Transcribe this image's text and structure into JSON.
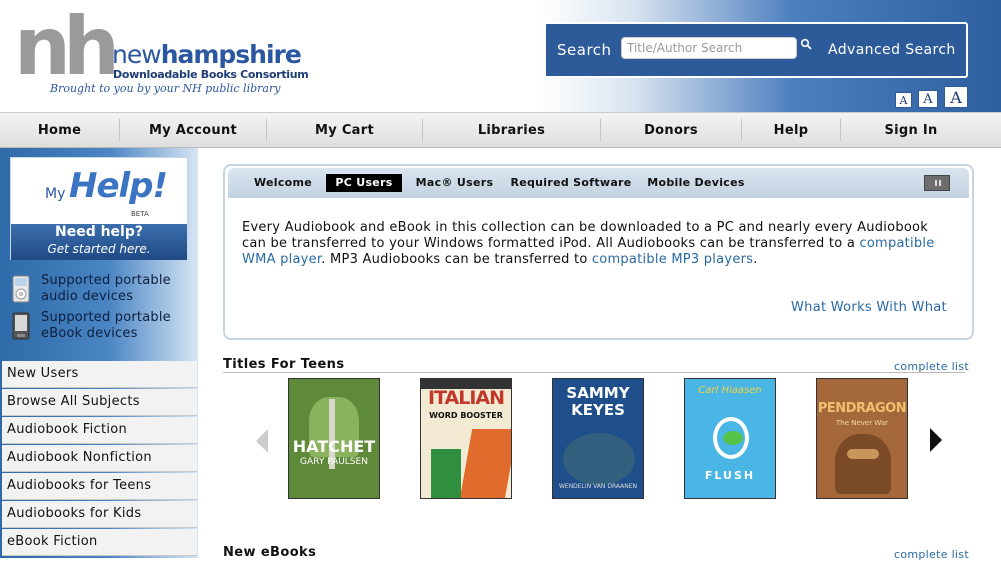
{
  "header": {
    "logo_nh": "nh",
    "logo_new": "new",
    "logo_hampshire": "hampshire",
    "logo_consortium": "Downloadable Books Consortium",
    "logo_tagline": "Brought to you by your NH public library",
    "search_label": "Search",
    "search_placeholder": "Title/Author Search",
    "advanced_search": "Advanced Search",
    "font_small": "A",
    "font_medium": "A",
    "font_large": "A"
  },
  "nav": {
    "items": [
      "Home",
      "My Account",
      "My Cart",
      "Libraries",
      "Donors",
      "Help",
      "Sign In"
    ]
  },
  "sidebar": {
    "myhelp_my": "My",
    "myhelp_help": "Help!",
    "myhelp_beta": "BETA",
    "need_help": "Need help?",
    "get_started": "Get started here.",
    "audio_devices": "Supported portable audio devices",
    "ebook_devices": "Supported portable eBook devices",
    "list": [
      "New Users",
      "Browse All Subjects",
      "Audiobook Fiction",
      "Audiobook Nonfiction",
      "Audiobooks for Teens",
      "Audiobooks for Kids",
      "eBook Fiction"
    ]
  },
  "welcome": {
    "tabs": [
      "Welcome",
      "PC Users",
      "Mac® Users",
      "Required Software",
      "Mobile Devices"
    ],
    "active_tab": "PC Users",
    "text_1": "Every Audiobook and eBook in this collection can be downloaded to a PC and nearly every Audiobook can be transferred to your Windows formatted iPod. All Audiobooks can be transferred to a ",
    "link_wma": "compatible WMA player",
    "text_2": ". MP3 Audiobooks can be transferred to ",
    "link_mp3": "compatible MP3 players",
    "text_3": ".",
    "what_works": "What Works With What"
  },
  "teens": {
    "title": "Titles For Teens",
    "complete_list": "complete list",
    "books": [
      {
        "title": "HATCHET",
        "author": "GARY PAULSEN",
        "bg": "#5f8a3a"
      },
      {
        "title": "ITALIAN",
        "author": "WORD BOOSTER",
        "bg": "#f2ead2"
      },
      {
        "title": "SAMMY KEYES",
        "author": "WENDELIN VAN DRAANEN",
        "bg": "#1f4f8a"
      },
      {
        "title": "FLUSH",
        "author": "Carl Hiaasen",
        "bg": "#49b6e6"
      },
      {
        "title": "PENDRAGON",
        "author": "The Never War",
        "bg": "#a4683a"
      }
    ]
  },
  "ebooks": {
    "title": "New eBooks",
    "complete_list": "complete list"
  }
}
